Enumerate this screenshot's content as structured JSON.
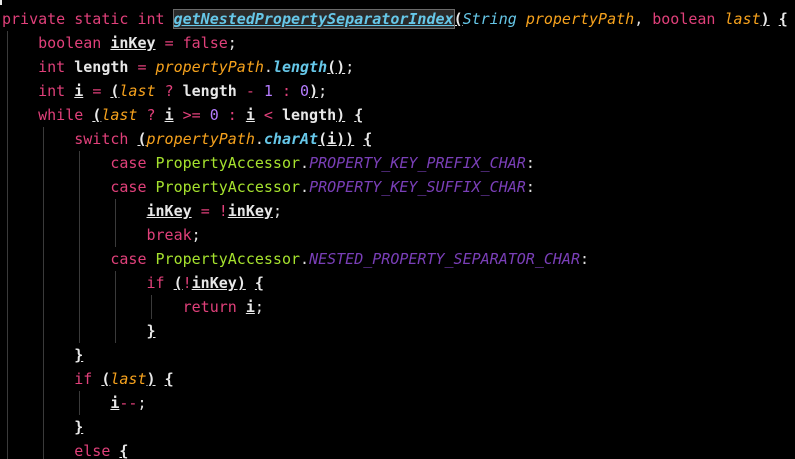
{
  "code_lines": [
    [
      [
        "t-kw",
        "private"
      ],
      [
        "t-plain",
        " "
      ],
      [
        "t-kw",
        "static"
      ],
      [
        "t-plain",
        " "
      ],
      [
        "t-ty",
        "int"
      ],
      [
        "t-plain",
        " "
      ],
      [
        "t-sel",
        "getNestedPropertySeparatorIndex"
      ],
      [
        "t-brace",
        "("
      ],
      [
        "t-mem",
        "String"
      ],
      [
        "t-plain",
        " "
      ],
      [
        "t-param",
        "propertyPath"
      ],
      [
        "t-plain",
        ", "
      ],
      [
        "t-ty",
        "boolean"
      ],
      [
        "t-plain",
        " "
      ],
      [
        "t-param",
        "last"
      ],
      [
        "t-brace",
        ")"
      ],
      [
        "t-plain",
        " "
      ],
      [
        "t-brace",
        "{"
      ]
    ],
    [
      [
        "t-plain",
        "    "
      ],
      [
        "t-ty",
        "boolean"
      ],
      [
        "t-plain",
        " "
      ],
      [
        "t-idx",
        "inKey"
      ],
      [
        "t-plain",
        " "
      ],
      [
        "t-op",
        "="
      ],
      [
        "t-plain",
        " "
      ],
      [
        "t-kw",
        "false"
      ],
      [
        "t-semi",
        ";"
      ]
    ],
    [
      [
        "t-plain",
        "    "
      ],
      [
        "t-ty",
        "int"
      ],
      [
        "t-plain",
        " "
      ],
      [
        "t-var",
        "length"
      ],
      [
        "t-plain",
        " "
      ],
      [
        "t-op",
        "="
      ],
      [
        "t-plain",
        " "
      ],
      [
        "t-param",
        "propertyPath"
      ],
      [
        "t-plain",
        "."
      ],
      [
        "t-meth",
        "length"
      ],
      [
        "t-brace",
        "()"
      ],
      [
        "t-semi",
        ";"
      ]
    ],
    [
      [
        "t-plain",
        "    "
      ],
      [
        "t-ty",
        "int"
      ],
      [
        "t-plain",
        " "
      ],
      [
        "t-idx",
        "i"
      ],
      [
        "t-plain",
        " "
      ],
      [
        "t-op",
        "="
      ],
      [
        "t-plain",
        " "
      ],
      [
        "t-brace",
        "("
      ],
      [
        "t-param",
        "last"
      ],
      [
        "t-plain",
        " "
      ],
      [
        "t-op",
        "?"
      ],
      [
        "t-plain",
        " "
      ],
      [
        "t-var",
        "length"
      ],
      [
        "t-plain",
        " "
      ],
      [
        "t-op",
        "-"
      ],
      [
        "t-plain",
        " "
      ],
      [
        "t-num",
        "1"
      ],
      [
        "t-plain",
        " "
      ],
      [
        "t-op",
        ":"
      ],
      [
        "t-plain",
        " "
      ],
      [
        "t-num",
        "0"
      ],
      [
        "t-brace",
        ")"
      ],
      [
        "t-semi",
        ";"
      ]
    ],
    [
      [
        "t-plain",
        "    "
      ],
      [
        "t-kw",
        "while"
      ],
      [
        "t-plain",
        " "
      ],
      [
        "t-brace",
        "("
      ],
      [
        "t-param",
        "last"
      ],
      [
        "t-plain",
        " "
      ],
      [
        "t-op",
        "?"
      ],
      [
        "t-plain",
        " "
      ],
      [
        "t-idx",
        "i"
      ],
      [
        "t-plain",
        " "
      ],
      [
        "t-op",
        ">="
      ],
      [
        "t-plain",
        " "
      ],
      [
        "t-num",
        "0"
      ],
      [
        "t-plain",
        " "
      ],
      [
        "t-op",
        ":"
      ],
      [
        "t-plain",
        " "
      ],
      [
        "t-idx",
        "i"
      ],
      [
        "t-plain",
        " "
      ],
      [
        "t-op",
        "<"
      ],
      [
        "t-plain",
        " "
      ],
      [
        "t-var",
        "length"
      ],
      [
        "t-brace",
        ")"
      ],
      [
        "t-plain",
        " "
      ],
      [
        "t-brace",
        "{"
      ]
    ],
    [
      [
        "t-plain",
        "        "
      ],
      [
        "t-kw",
        "switch"
      ],
      [
        "t-plain",
        " "
      ],
      [
        "t-brace",
        "("
      ],
      [
        "t-param",
        "propertyPath"
      ],
      [
        "t-plain",
        "."
      ],
      [
        "t-meth",
        "charAt"
      ],
      [
        "t-brace",
        "("
      ],
      [
        "t-idx",
        "i"
      ],
      [
        "t-brace",
        "))"
      ],
      [
        "t-plain",
        " "
      ],
      [
        "t-brace",
        "{"
      ]
    ],
    [
      [
        "t-plain",
        "            "
      ],
      [
        "t-kw",
        "case"
      ],
      [
        "t-plain",
        " "
      ],
      [
        "t-cls",
        "PropertyAccessor"
      ],
      [
        "t-plain",
        "."
      ],
      [
        "t-fld",
        "PROPERTY_KEY_PREFIX_CHAR"
      ],
      [
        "t-plain",
        ":"
      ]
    ],
    [
      [
        "t-plain",
        "            "
      ],
      [
        "t-kw",
        "case"
      ],
      [
        "t-plain",
        " "
      ],
      [
        "t-cls",
        "PropertyAccessor"
      ],
      [
        "t-plain",
        "."
      ],
      [
        "t-fld",
        "PROPERTY_KEY_SUFFIX_CHAR"
      ],
      [
        "t-plain",
        ":"
      ]
    ],
    [
      [
        "t-plain",
        "                "
      ],
      [
        "t-idx",
        "inKey"
      ],
      [
        "t-plain",
        " "
      ],
      [
        "t-op",
        "="
      ],
      [
        "t-plain",
        " "
      ],
      [
        "t-op",
        "!"
      ],
      [
        "t-idx",
        "inKey"
      ],
      [
        "t-semi",
        ";"
      ]
    ],
    [
      [
        "t-plain",
        "                "
      ],
      [
        "t-kw",
        "break"
      ],
      [
        "t-semi",
        ";"
      ]
    ],
    [
      [
        "t-plain",
        "            "
      ],
      [
        "t-kw",
        "case"
      ],
      [
        "t-plain",
        " "
      ],
      [
        "t-cls",
        "PropertyAccessor"
      ],
      [
        "t-plain",
        "."
      ],
      [
        "t-fld",
        "NESTED_PROPERTY_SEPARATOR_CHAR"
      ],
      [
        "t-plain",
        ":"
      ]
    ],
    [
      [
        "t-plain",
        "                "
      ],
      [
        "t-kw",
        "if"
      ],
      [
        "t-plain",
        " "
      ],
      [
        "t-brace",
        "("
      ],
      [
        "t-op",
        "!"
      ],
      [
        "t-idx",
        "inKey"
      ],
      [
        "t-brace",
        ")"
      ],
      [
        "t-plain",
        " "
      ],
      [
        "t-brace",
        "{"
      ]
    ],
    [
      [
        "t-plain",
        "                    "
      ],
      [
        "t-kw",
        "return"
      ],
      [
        "t-plain",
        " "
      ],
      [
        "t-idx",
        "i"
      ],
      [
        "t-semi",
        ";"
      ]
    ],
    [
      [
        "t-plain",
        "                "
      ],
      [
        "t-brace",
        "}"
      ]
    ],
    [
      [
        "t-plain",
        "        "
      ],
      [
        "t-brace",
        "}"
      ]
    ],
    [
      [
        "t-plain",
        "        "
      ],
      [
        "t-kw",
        "if"
      ],
      [
        "t-plain",
        " "
      ],
      [
        "t-brace",
        "("
      ],
      [
        "t-param",
        "last"
      ],
      [
        "t-brace",
        ")"
      ],
      [
        "t-plain",
        " "
      ],
      [
        "t-brace",
        "{"
      ]
    ],
    [
      [
        "t-plain",
        "            "
      ],
      [
        "t-idx",
        "i"
      ],
      [
        "t-op",
        "--"
      ],
      [
        "t-semi",
        ";"
      ]
    ],
    [
      [
        "t-plain",
        "        "
      ],
      [
        "t-brace",
        "}"
      ]
    ],
    [
      [
        "t-plain",
        "        "
      ],
      [
        "t-kw",
        "else"
      ],
      [
        "t-plain",
        " "
      ],
      [
        "t-brace",
        "{"
      ]
    ]
  ],
  "line_names": [
    "method-signature-line",
    "inkey-declaration-line",
    "length-declaration-line",
    "index-declaration-line",
    "while-loop-line",
    "switch-line",
    "case-prefix-line",
    "case-suffix-line",
    "toggle-inkey-line",
    "break-line",
    "case-separator-line",
    "if-not-inkey-line",
    "return-line",
    "if-close-brace-line",
    "switch-close-brace-line",
    "if-last-line",
    "decrement-line",
    "if-last-close-brace-line",
    "else-line"
  ]
}
